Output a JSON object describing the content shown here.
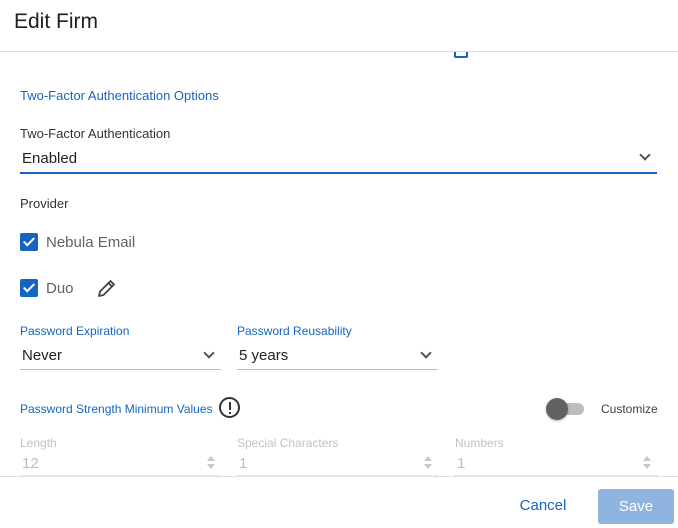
{
  "dialog": {
    "title": "Edit Firm"
  },
  "two_factor": {
    "section_title": "Two-Factor Authentication Options",
    "field_label": "Two-Factor Authentication",
    "value": "Enabled"
  },
  "provider": {
    "label": "Provider",
    "options": [
      {
        "label": "Nebula Email",
        "checked": true
      },
      {
        "label": "Duo",
        "checked": true,
        "edit_icon": "pencil-icon"
      }
    ]
  },
  "password_expiration": {
    "label": "Password Expiration",
    "value": "Never"
  },
  "password_reusability": {
    "label": "Password Reusability",
    "value": "5 years"
  },
  "password_strength": {
    "title": "Password Strength Minimum Values",
    "info_icon": "info-circle-icon",
    "customize_label": "Customize",
    "customize_enabled": false,
    "fields": [
      {
        "label": "Length",
        "value": "12"
      },
      {
        "label": "Special Characters",
        "value": "1"
      },
      {
        "label": "Numbers",
        "value": "1"
      }
    ]
  },
  "footer": {
    "cancel_label": "Cancel",
    "save_label": "Save"
  },
  "colors": {
    "accent": "#1565c0",
    "save_disabled": "#90b4e0",
    "toggle_off_thumb": "#616161"
  }
}
